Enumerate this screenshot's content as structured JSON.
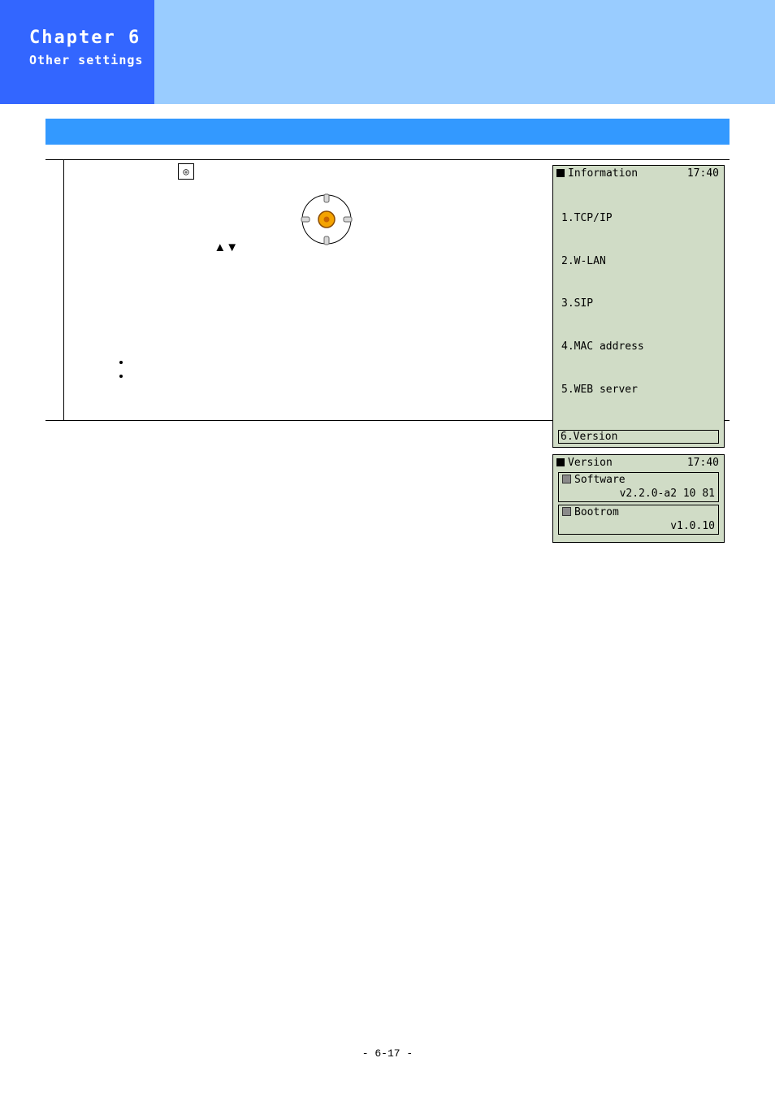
{
  "header": {
    "chapter": "Chapter 6",
    "subtitle": "Other settings"
  },
  "step": {
    "updown_glyphs": "▲▼",
    "center_glyph": "◎"
  },
  "info_screen": {
    "title": "Information",
    "time": "17:40",
    "items": [
      "1.TCP/IP",
      "2.W-LAN",
      "3.SIP",
      "4.MAC address",
      "5.WEB server"
    ],
    "selected": "6.Version"
  },
  "version_screen": {
    "title": "Version",
    "time": "17:40",
    "rows": [
      {
        "label": "Software",
        "value": "v2.2.0-a2 10 81"
      },
      {
        "label": "Bootrom",
        "value": "v1.0.10"
      }
    ]
  },
  "footer": {
    "page": "- 6-17 -"
  }
}
